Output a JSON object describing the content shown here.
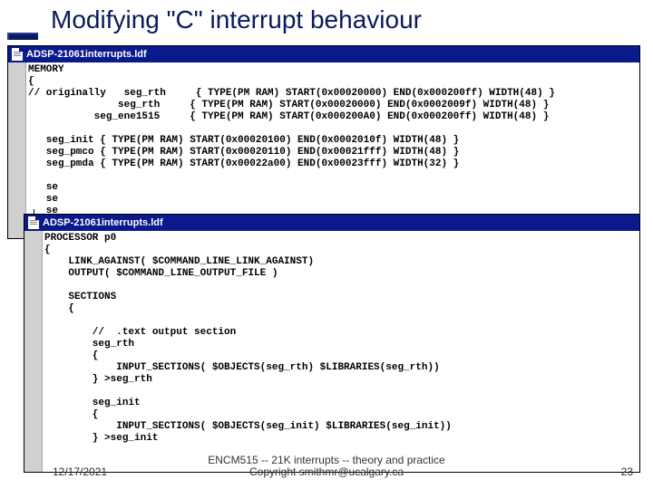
{
  "slide": {
    "title": "Modifying \"C\" interrupt behaviour"
  },
  "window1": {
    "filename": "ADSP-21061interrupts.ldf",
    "code": "MEMORY\n{\n// originally   seg_rth     { TYPE(PM RAM) START(0x00020000) END(0x000200ff) WIDTH(48) }\n               seg_rth     { TYPE(PM RAM) START(0x00020000) END(0x0002009f) WIDTH(48) }\n           seg_ene1515     { TYPE(PM RAM) START(0x000200A0) END(0x000200ff) WIDTH(48) }\n\n   seg_init { TYPE(PM RAM) START(0x00020100) END(0x0002010f) WIDTH(48) }\n   seg_pmco { TYPE(PM RAM) START(0x00020110) END(0x00021fff) WIDTH(48) }\n   seg_pmda { TYPE(PM RAM) START(0x00022a00) END(0x00023fff) WIDTH(32) }\n\n   se\n   se\n   se\n}"
  },
  "window2": {
    "filename": "ADSP-21061interrupts.ldf",
    "code": "PROCESSOR p0\n{\n    LINK_AGAINST( $COMMAND_LINE_LINK_AGAINST)\n    OUTPUT( $COMMAND_LINE_OUTPUT_FILE )\n\n    SECTIONS\n    {\n\n        //  .text output section\n        seg_rth\n        {\n            INPUT_SECTIONS( $OBJECTS(seg_rth) $LIBRARIES(seg_rth))\n        } >seg_rth\n\n        seg_init\n        {\n            INPUT_SECTIONS( $OBJECTS(seg_init) $LIBRARIES(seg_init))\n        } >seg_init"
  },
  "footer": {
    "date": "12/17/2021",
    "line1": "ENCM515 -- 21K interrupts -- theory and practice",
    "line2": "Copyright smithmr@ucalgary.ca",
    "page": "23"
  }
}
